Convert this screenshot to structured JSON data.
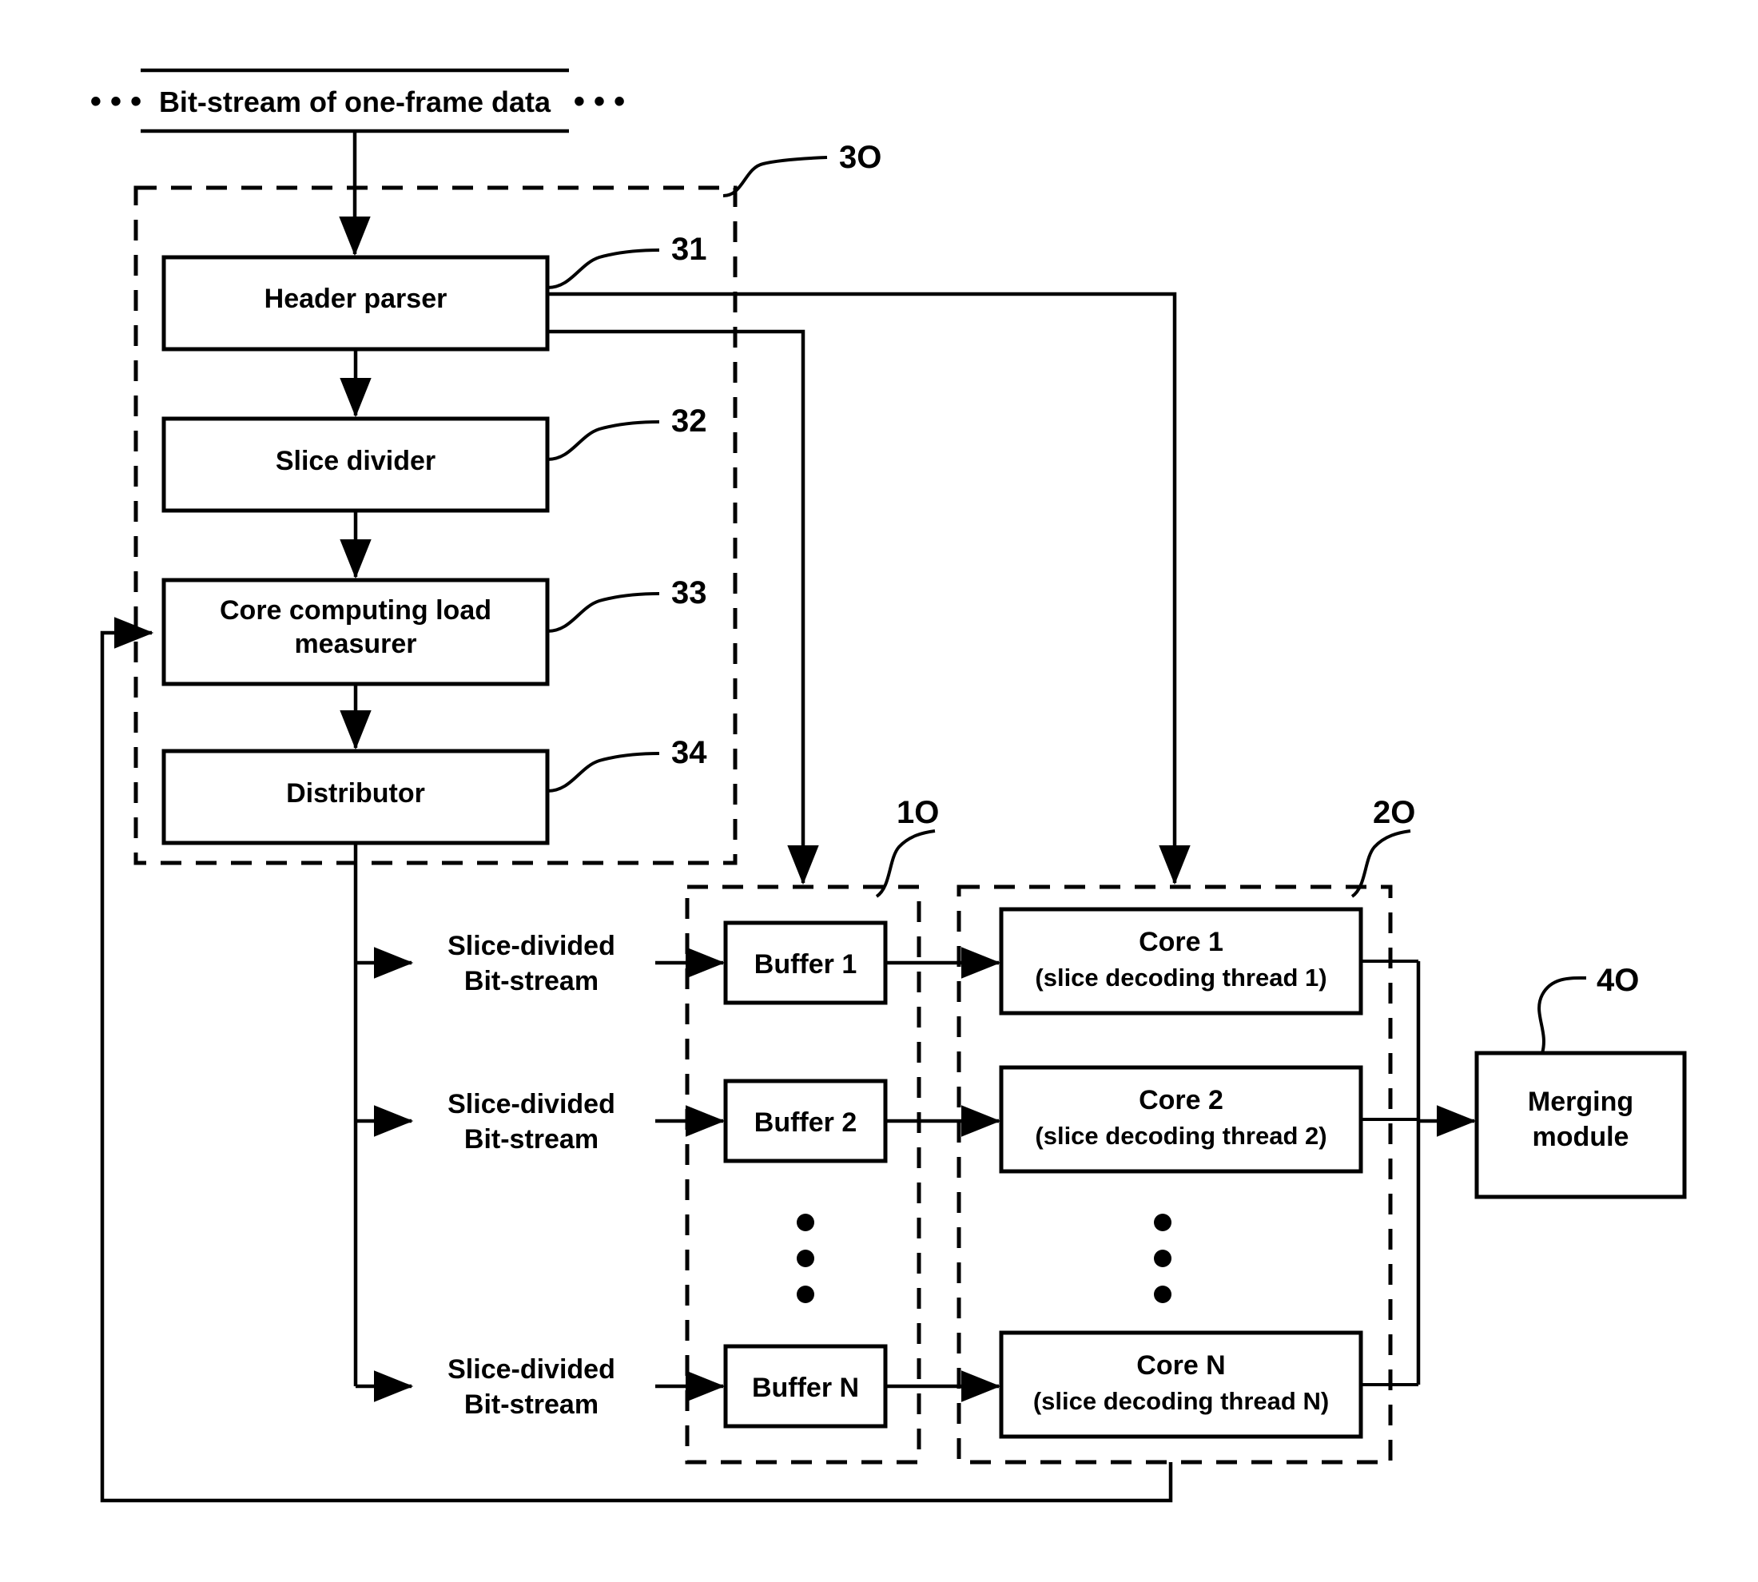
{
  "figure": {
    "input_stream": {
      "label": "Bit-stream of one-frame data",
      "left_ellipsis": "• • •",
      "right_ellipsis": "• • •"
    },
    "regions": [
      {
        "id": "region-30",
        "ref": "3O"
      },
      {
        "id": "region-10",
        "ref": "1O"
      },
      {
        "id": "region-20",
        "ref": "2O"
      }
    ],
    "parser_module": {
      "ref": "3O",
      "blocks": [
        {
          "name": "header-parser",
          "label": "Header parser",
          "ref": "31"
        },
        {
          "name": "slice-divider",
          "label": "Slice divider",
          "ref": "32"
        },
        {
          "name": "core-computing-load-measurer",
          "label_line1": "Core computing load",
          "label_line2": "measurer",
          "ref": "33"
        },
        {
          "name": "distributor",
          "label": "Distributor",
          "ref": "34"
        }
      ]
    },
    "slice_streams": [
      {
        "line1": "Slice-divided",
        "line2": "Bit-stream"
      },
      {
        "line1": "Slice-divided",
        "line2": "Bit-stream"
      },
      {
        "line1": "Slice-divided",
        "line2": "Bit-stream"
      }
    ],
    "buffer_module": {
      "ref": "1O",
      "buffers": [
        {
          "label": "Buffer 1"
        },
        {
          "label": "Buffer 2"
        },
        {
          "label": "Buffer N"
        }
      ],
      "ellipsis": "vertical-three-dots"
    },
    "core_module": {
      "ref": "2O",
      "cores": [
        {
          "line1": "Core 1",
          "line2": "(slice decoding thread 1)"
        },
        {
          "line1": "Core 2",
          "line2": "(slice decoding thread 2)"
        },
        {
          "line1": "Core N",
          "line2": "(slice decoding thread N)"
        }
      ],
      "ellipsis": "vertical-three-dots"
    },
    "merging_module": {
      "ref": "4O",
      "line1": "Merging",
      "line2": "module"
    },
    "colors": {
      "stroke": "#000000",
      "fill": "#ffffff",
      "background": "#ffffff"
    }
  }
}
